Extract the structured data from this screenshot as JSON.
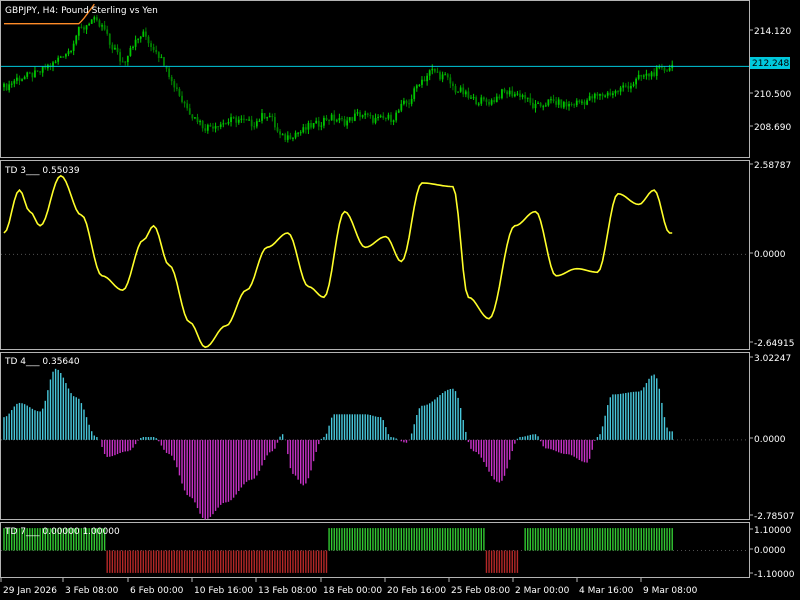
{
  "window": {
    "symbol_title": "GBPJPY, H4:  Pound Sterling vs Yen"
  },
  "colors": {
    "background": "#000000",
    "frame": "#b4b4b4",
    "bull_candle": "#00c800",
    "bear_candle": "#008000",
    "price_line": "#00c8dc",
    "ma_line": "#ff8c28",
    "td3_line": "#ffff2a",
    "td4_pos": "#48c8dc",
    "td4_neg": "#c832c8",
    "td7_pos": "#32c832",
    "td7_neg": "#b42828"
  },
  "panes": {
    "main": {
      "price_levels": [
        "214.120",
        "210.500",
        "208.690"
      ],
      "current_price": "212.248"
    },
    "td3": {
      "title": "TD 3___  0.55039",
      "levels": [
        "2.58787",
        "0.0000",
        "-2.64915"
      ]
    },
    "td4": {
      "title": "TD 4___  0.35640",
      "levels": [
        "3.02247",
        "0.0000",
        "-2.78507"
      ]
    },
    "td7": {
      "title": "TD 7___  0.00000 1.00000",
      "levels": [
        "1.10000",
        "0.0000",
        "-1.10000"
      ]
    }
  },
  "time_axis": [
    "29 Jan 2026",
    "3 Feb 08:00",
    "6 Feb 00:00",
    "10 Feb 16:00",
    "13 Feb 08:00",
    "18 Feb 00:00",
    "20 Feb 16:00",
    "25 Feb 08:00",
    "2 Mar 00:00",
    "4 Mar 16:00",
    "9 Mar 08:00"
  ],
  "chart_data": [
    {
      "type": "candlestick",
      "symbol": "GBPJPY",
      "timeframe": "H4",
      "ylim": [
        207.3,
        215.8
      ],
      "anchor_closes": [
        [
          0,
          211.1
        ],
        [
          6,
          211.6
        ],
        [
          12,
          211.8
        ],
        [
          18,
          212.3
        ],
        [
          24,
          213.0
        ],
        [
          30,
          214.3
        ],
        [
          34,
          214.8
        ],
        [
          38,
          214.4
        ],
        [
          42,
          213.3
        ],
        [
          46,
          212.5
        ],
        [
          50,
          213.5
        ],
        [
          54,
          214.0
        ],
        [
          58,
          213.3
        ],
        [
          62,
          212.5
        ],
        [
          66,
          211.2
        ],
        [
          70,
          210.2
        ],
        [
          74,
          209.4
        ],
        [
          78,
          208.9
        ],
        [
          84,
          209.1
        ],
        [
          90,
          209.3
        ],
        [
          96,
          209.1
        ],
        [
          102,
          209.6
        ],
        [
          108,
          208.3
        ],
        [
          114,
          208.6
        ],
        [
          120,
          209.0
        ],
        [
          126,
          209.4
        ],
        [
          132,
          209.2
        ],
        [
          138,
          209.6
        ],
        [
          144,
          209.3
        ],
        [
          150,
          209.4
        ],
        [
          156,
          210.2
        ],
        [
          162,
          211.5
        ],
        [
          166,
          212.0
        ],
        [
          170,
          211.7
        ],
        [
          176,
          210.9
        ],
        [
          182,
          210.4
        ],
        [
          188,
          210.3
        ],
        [
          194,
          210.8
        ],
        [
          200,
          210.7
        ],
        [
          206,
          210.0
        ],
        [
          212,
          210.3
        ],
        [
          218,
          210.1
        ],
        [
          224,
          210.3
        ],
        [
          230,
          210.6
        ],
        [
          236,
          210.8
        ],
        [
          242,
          211.2
        ],
        [
          248,
          211.7
        ],
        [
          254,
          212.0
        ],
        [
          260,
          212.3
        ]
      ],
      "current_price": 212.248
    },
    {
      "type": "line",
      "name": "TD 3",
      "ylim": [
        -2.64915,
        2.58787
      ],
      "anchors": [
        [
          0,
          0.6
        ],
        [
          6,
          1.8
        ],
        [
          10,
          1.2
        ],
        [
          14,
          0.8
        ],
        [
          22,
          2.2
        ],
        [
          30,
          1.1
        ],
        [
          38,
          -0.6
        ],
        [
          46,
          -1.0
        ],
        [
          54,
          0.4
        ],
        [
          58,
          0.8
        ],
        [
          64,
          -0.3
        ],
        [
          72,
          -1.9
        ],
        [
          78,
          -2.6
        ],
        [
          86,
          -2.0
        ],
        [
          94,
          -1.0
        ],
        [
          102,
          0.2
        ],
        [
          110,
          0.6
        ],
        [
          118,
          -0.9
        ],
        [
          124,
          -1.2
        ],
        [
          132,
          1.2
        ],
        [
          140,
          0.2
        ],
        [
          148,
          0.5
        ],
        [
          154,
          -0.2
        ],
        [
          162,
          2.0
        ],
        [
          174,
          1.9
        ],
        [
          180,
          -1.2
        ],
        [
          188,
          -1.8
        ],
        [
          198,
          0.8
        ],
        [
          206,
          1.2
        ],
        [
          214,
          -0.6
        ],
        [
          222,
          -0.4
        ],
        [
          230,
          -0.5
        ],
        [
          238,
          1.7
        ],
        [
          246,
          1.4
        ],
        [
          252,
          1.8
        ],
        [
          258,
          0.6
        ]
      ],
      "last_value": 0.55039
    },
    {
      "type": "bar",
      "name": "TD 4",
      "ylim": [
        -2.78507,
        3.02247
      ],
      "anchors": [
        [
          0,
          0.8
        ],
        [
          6,
          1.3
        ],
        [
          14,
          1.0
        ],
        [
          20,
          2.5
        ],
        [
          28,
          1.5
        ],
        [
          36,
          0.1
        ],
        [
          40,
          -0.6
        ],
        [
          48,
          -0.4
        ],
        [
          54,
          0.1
        ],
        [
          58,
          0.1
        ],
        [
          64,
          -0.5
        ],
        [
          72,
          -2.0
        ],
        [
          78,
          -2.8
        ],
        [
          86,
          -2.2
        ],
        [
          96,
          -1.4
        ],
        [
          104,
          -0.4
        ],
        [
          108,
          0.2
        ],
        [
          112,
          -1.2
        ],
        [
          116,
          -1.6
        ],
        [
          124,
          0.1
        ],
        [
          128,
          0.9
        ],
        [
          140,
          0.9
        ],
        [
          146,
          0.8
        ],
        [
          150,
          0.1
        ],
        [
          156,
          -0.1
        ],
        [
          162,
          1.2
        ],
        [
          174,
          1.8
        ],
        [
          182,
          -0.4
        ],
        [
          192,
          -1.5
        ],
        [
          200,
          0.1
        ],
        [
          206,
          0.2
        ],
        [
          210,
          -0.3
        ],
        [
          218,
          -0.5
        ],
        [
          226,
          -0.8
        ],
        [
          230,
          0.1
        ],
        [
          236,
          1.6
        ],
        [
          246,
          1.7
        ],
        [
          252,
          2.3
        ],
        [
          258,
          0.3
        ]
      ],
      "last_value": 0.3564
    },
    {
      "type": "bar",
      "name": "TD 7",
      "ylim": [
        -1.1,
        1.1
      ],
      "segments": [
        {
          "from": 0,
          "to": 39,
          "value": 1
        },
        {
          "from": 40,
          "to": 125,
          "value": -1
        },
        {
          "from": 126,
          "to": 186,
          "value": 1
        },
        {
          "from": 187,
          "to": 199,
          "value": -1
        },
        {
          "from": 200,
          "to": 201,
          "value": 0
        },
        {
          "from": 202,
          "to": 259,
          "value": 1
        }
      ],
      "last_values": [
        0.0,
        1.0
      ]
    }
  ]
}
